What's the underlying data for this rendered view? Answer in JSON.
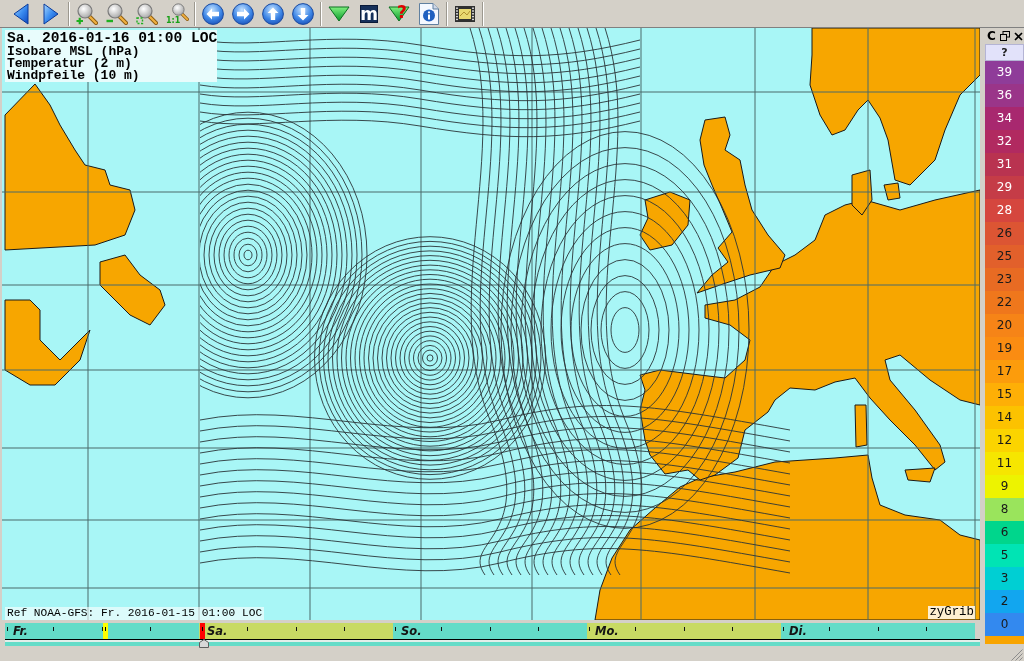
{
  "toolbar": [
    {
      "buttons": [
        {
          "kind": "back"
        },
        {
          "kind": "forward"
        }
      ]
    },
    {
      "buttons": [
        {
          "kind": "zoom-in"
        },
        {
          "kind": "zoom-out"
        },
        {
          "kind": "zoom-fit"
        },
        {
          "kind": "zoom-actual",
          "label": "1:1"
        }
      ]
    },
    {
      "buttons": [
        {
          "kind": "pan-left"
        },
        {
          "kind": "pan-right"
        },
        {
          "kind": "pan-up"
        },
        {
          "kind": "pan-down"
        }
      ]
    },
    {
      "buttons": [
        {
          "kind": "download"
        },
        {
          "kind": "logo",
          "label": "m"
        },
        {
          "kind": "status",
          "label": "?"
        },
        {
          "kind": "info"
        }
      ]
    },
    {
      "buttons": [
        {
          "kind": "animation"
        }
      ]
    }
  ],
  "map": {
    "datetime": "Sa. 2016-01-16 01:00 LOC",
    "layers": [
      "Isobare MSL (hPa)",
      "Temperatur (2 m)",
      "Windpfeile (10 m)"
    ],
    "reference": "Ref NOAA-GFS: Fr. 2016-01-15 01:00 LOC",
    "credit": "zyGrib"
  },
  "timeline": {
    "days": [
      {
        "label": "Fr.",
        "color": "#64dcc8"
      },
      {
        "label": "Sa.",
        "color": "#c8da64"
      },
      {
        "label": "So.",
        "color": "#64dcc8"
      },
      {
        "label": "Mo.",
        "color": "#c8da64"
      },
      {
        "label": "Di.",
        "color": "#64dcc8"
      }
    ],
    "markers": [
      {
        "color": "#ffff00",
        "level": 0.104
      },
      {
        "color": "#ff0000",
        "level": 0.204
      }
    ],
    "slider": {
      "level": 0.204
    }
  },
  "legend": {
    "title": "C",
    "unit": "?",
    "entries": [
      {
        "label": "39",
        "color": "#8f3c99"
      },
      {
        "label": "36",
        "color": "#9a3589"
      },
      {
        "label": "34",
        "color": "#a8286f"
      },
      {
        "label": "32",
        "color": "#b12a60"
      },
      {
        "label": "31",
        "color": "#b93350"
      },
      {
        "label": "29",
        "color": "#c53c47"
      },
      {
        "label": "28",
        "color": "#d5463e"
      },
      {
        "label": "26",
        "color": "#dc5533"
      },
      {
        "label": "25",
        "color": "#e2602b"
      },
      {
        "label": "23",
        "color": "#e86b23"
      },
      {
        "label": "22",
        "color": "#ef771c"
      },
      {
        "label": "20",
        "color": "#f68417"
      },
      {
        "label": "19",
        "color": "#fa8c12"
      },
      {
        "label": "17",
        "color": "#fc9c0c"
      },
      {
        "label": "15",
        "color": "#feaf06"
      },
      {
        "label": "14",
        "color": "#fcc200"
      },
      {
        "label": "12",
        "color": "#fbd400"
      },
      {
        "label": "11",
        "color": "#f6e600"
      },
      {
        "label": "9",
        "color": "#edf300"
      },
      {
        "label": "8",
        "color": "#9ae45c"
      },
      {
        "label": "6",
        "color": "#00d68c"
      },
      {
        "label": "5",
        "color": "#00e4b4"
      },
      {
        "label": "3",
        "color": "#00cfd3"
      },
      {
        "label": "2",
        "color": "#12a6ef"
      },
      {
        "label": "0",
        "color": "#3389ef"
      }
    ]
  }
}
